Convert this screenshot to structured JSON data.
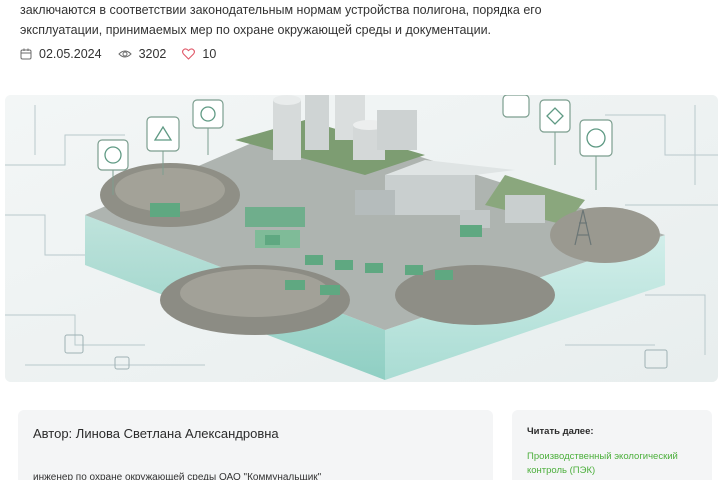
{
  "intro": {
    "line1": "заключаются в соответствии законодательным нормам устройства полигона, порядка его",
    "line2": "эксплуатации, принимаемых мер по охране окружающей среды и документации."
  },
  "meta": {
    "date": "02.05.2024",
    "views": "3202",
    "likes": "10",
    "icons": {
      "date": "calendar-icon",
      "views": "eye-icon",
      "likes": "heart-icon"
    },
    "colors": {
      "heart": "#e05a6a",
      "icon": "#6b6b6b"
    }
  },
  "hero": {
    "subject": "landfill-illustration"
  },
  "author": {
    "name": "Автор: Линова Светлана Александровна",
    "role": "инженер по охране окружающей среды ОАО \"Коммунальщик\""
  },
  "read_next": {
    "title": "Читать далее:",
    "link": "Производственный экологический контроль (ПЭК)",
    "link_color": "#4caf3c"
  }
}
